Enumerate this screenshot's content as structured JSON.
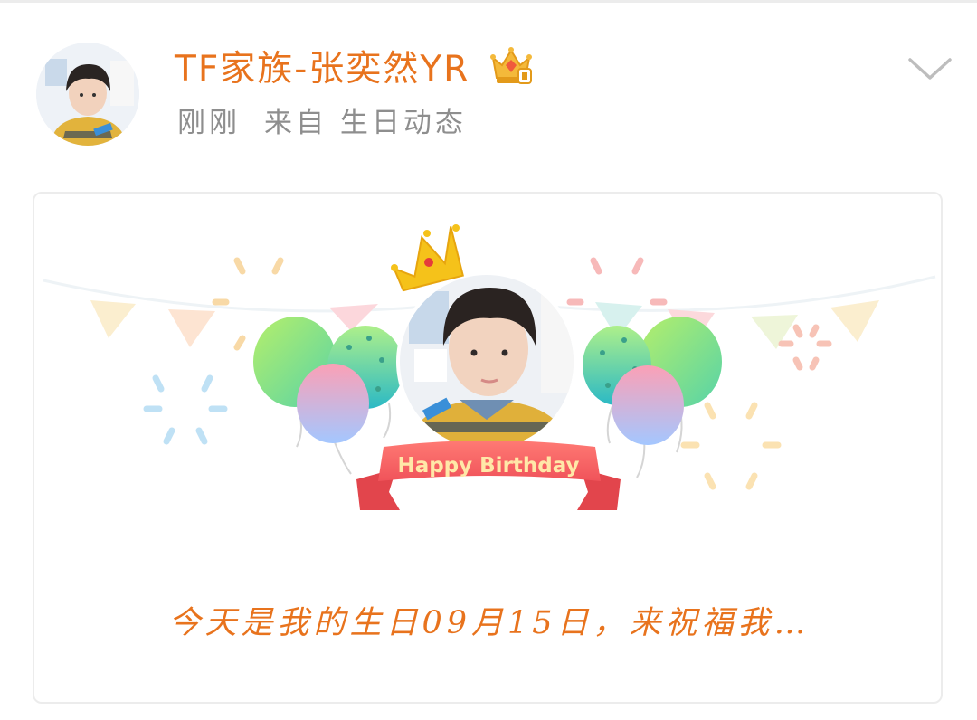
{
  "post": {
    "username": "TF家族-张奕然YR",
    "time": "刚刚",
    "source": "来自 生日动态",
    "icons": {
      "vip": "crown-vip-badge-icon",
      "more": "chevron-down-icon"
    }
  },
  "card": {
    "banner_text": "Happy Birthday",
    "greeting": "今天是我的生日09月15日，来祝福我…",
    "colors": {
      "accent": "#e8731d",
      "ribbon": "#f0535a",
      "crown": "#f5c21a"
    }
  }
}
